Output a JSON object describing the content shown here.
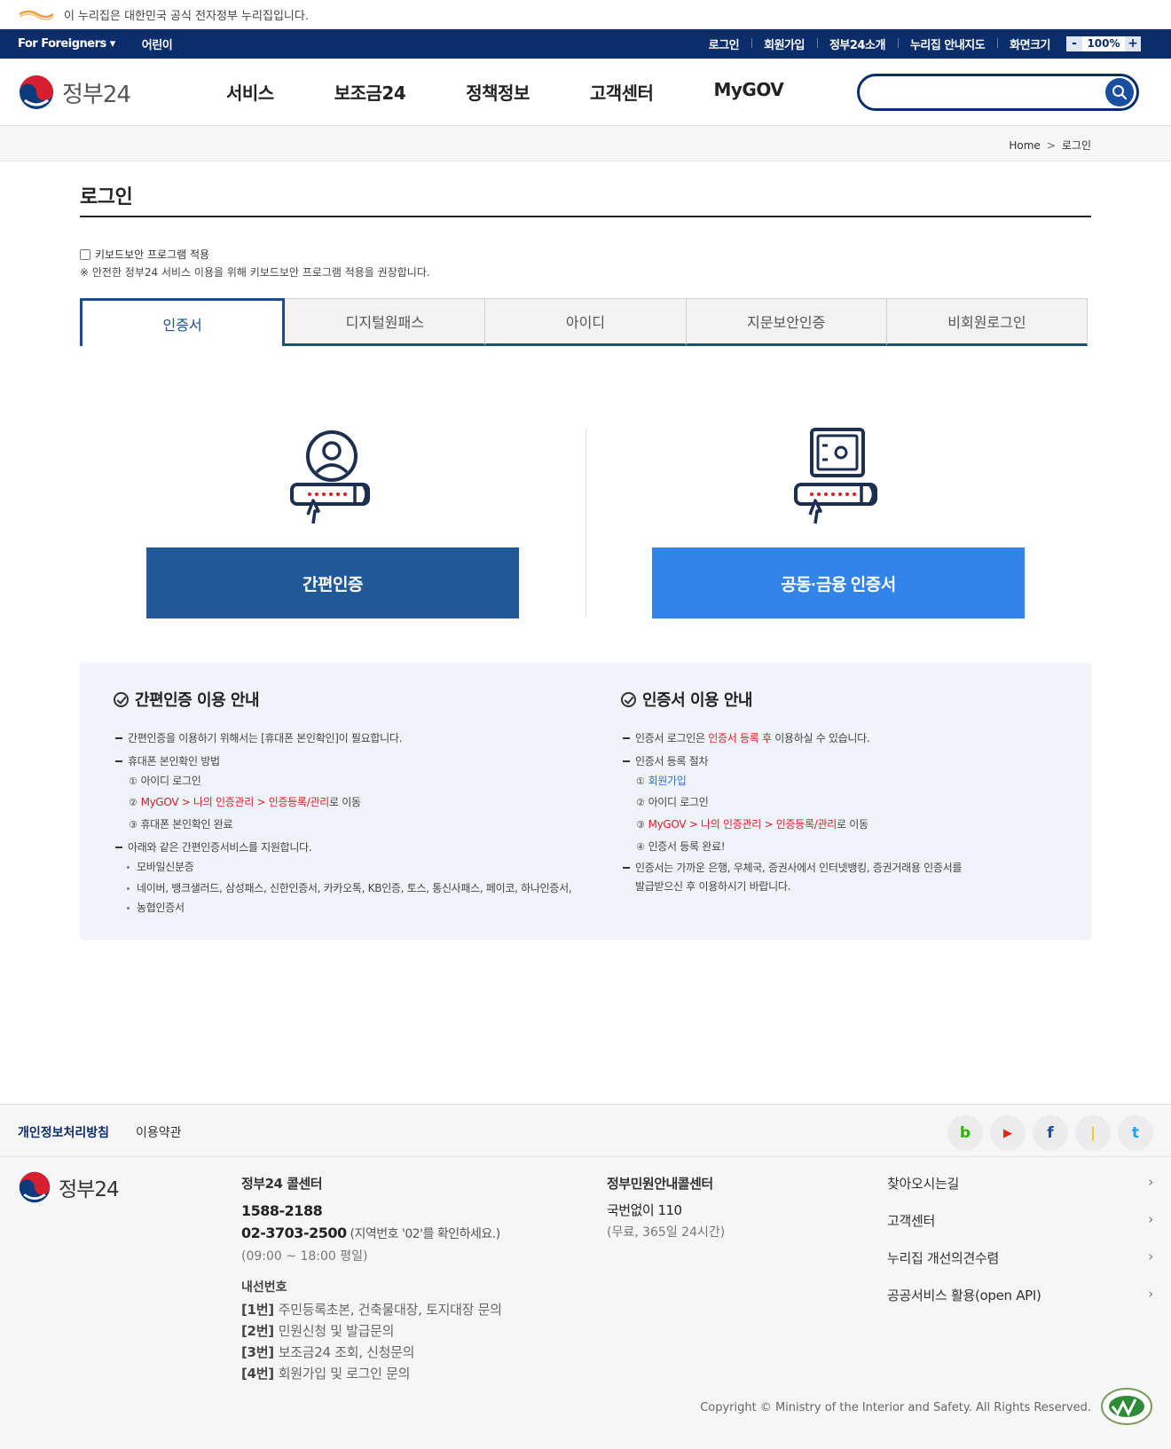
{
  "gov_bar": {
    "notice": "이 누리집은 대한민국 공식 전자정부 누리집입니다."
  },
  "util_bar": {
    "foreigners": "For Foreigners ▾",
    "kids": "어린이",
    "links": [
      "로그인",
      "회원가입",
      "정부24소개",
      "누리집 안내지도",
      "화면크기"
    ],
    "zoom_minus": "-",
    "zoom_value": "100%",
    "zoom_plus": "+"
  },
  "header": {
    "brand": "정부24",
    "nav": [
      "서비스",
      "보조금24",
      "정책정보",
      "고객센터",
      "MyGOV"
    ],
    "search_placeholder": ""
  },
  "breadcrumb": {
    "home": "Home",
    "sep": ">",
    "current": "로그인"
  },
  "page": {
    "title": "로그인",
    "kb_label": "키보드보안 프로그램 적용",
    "kb_note": "※ 안전한 정부24 서비스 이용을 위해 키보드보안 프로그램 적용을 권장합니다."
  },
  "tabs": [
    "인증서",
    "디지털원패스",
    "아이디",
    "지문보안인증",
    "비회원로그인"
  ],
  "login_options": {
    "simple": "간편인증",
    "cert": "공동·금융 인증서"
  },
  "guide_left": {
    "title": "간편인증 이용 안내",
    "item1": "간편인증을 이용하기 위해서는 [휴대폰 본인확인]이 필요합니다.",
    "item2": "휴대폰 본인확인 방법",
    "step1": "아이디 로그인",
    "step2_link": "MyGOV > 나의 인증관리 > 인증등록/관리",
    "step2_suffix": "로 이동",
    "step3": "휴대폰 본인확인 완료",
    "item3": "아래와 같은 간편인증서비스를 지원합니다.",
    "dot1": "모바일신분증",
    "dot2": "네이버, 뱅크샐러드, 삼성패스, 신한인증서, 카카오톡, KB인증, 토스, 통신사패스, 페이코, 하나인증서,",
    "dot2b": "농협인증서",
    "nums": [
      "①",
      "②",
      "③"
    ]
  },
  "guide_right": {
    "title": "인증서 이용 안내",
    "item1_pre": "인증서 로그인은 ",
    "item1_red": "인증서 등록 후",
    "item1_post": " 이용하실 수 있습니다.",
    "item2": "인증서 등록 절차",
    "step1": "회원가입",
    "step2": "아이디 로그인",
    "step3_link": "MyGOV > 나의 인증관리 > 인증등록/관리",
    "step3_suffix": "로 이동",
    "step4": "인증서 등록 완료!",
    "item3": "인증서는 가까운 은행, 우체국, 증권사에서 인터넷뱅킹, 증권거래용 인증서를",
    "item3b": "발급받으신 후 이용하시기 바랍니다.",
    "nums": [
      "①",
      "②",
      "③",
      "④"
    ]
  },
  "footer": {
    "privacy": "개인정보처리방침",
    "terms": "이용약관",
    "brand": "정부24",
    "call1_title": "정부24 콜센터",
    "call1_num1": "1588-2188",
    "call1_num2": "02-3703-2500",
    "call1_note_open": " (",
    "call1_note_red": "지역번호 '02'",
    "call1_note_close": "를 확인하세요.)",
    "call1_hours": "(09:00 ~ 18:00 평일)",
    "ext_title": "내선번호",
    "ext": [
      {
        "k": "[1번]",
        "v": "주민등록초본, 건축물대장, 토지대장 문의"
      },
      {
        "k": "[2번]",
        "v": "민원신청 및 발급문의"
      },
      {
        "k": "[3번]",
        "v": "보조금24 조회, 신청문의"
      },
      {
        "k": "[4번]",
        "v": "회원가입 및 로그인 문의"
      }
    ],
    "call2_title": "정부민원안내콜센터",
    "call2_num": "국번없이 110",
    "call2_note": "(무료, 365일 24시간)",
    "quick": [
      "찾아오시는길",
      "고객센터",
      "누리집 개선의견수렴",
      "공공서비스 활용(open API)"
    ],
    "copyright": "Copyright © Ministry of the Interior and Safety. All Rights Reserved.",
    "social": [
      "b",
      "▶",
      "f",
      "❘",
      "t"
    ]
  },
  "colors": {
    "navy": "#0b2e6b",
    "simple_btn": "#1f5a96",
    "cert_btn": "#3384e8",
    "accent_red": "#d4202c"
  }
}
